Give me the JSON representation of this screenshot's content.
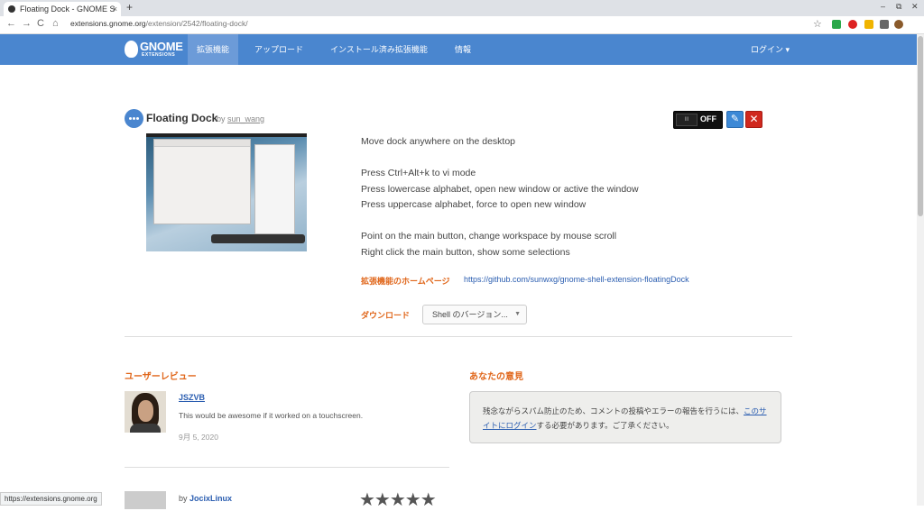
{
  "browser": {
    "tab_title": "Floating Dock - GNOME S",
    "tab_close": "×",
    "new_tab": "+",
    "url_host": "extensions.gnome.org",
    "url_path": "/extension/2542/floating-dock/",
    "back": "←",
    "forward": "→",
    "reload": "C",
    "home": "⌂",
    "star": "☆",
    "minimize": "–",
    "restore": "⧉",
    "close": "✕"
  },
  "site": {
    "logo_main": "GNOME",
    "logo_sub": "EXTENSIONS",
    "nav": [
      "拡張機能",
      "アップロード",
      "インストール済み拡張機能",
      "情報"
    ],
    "login": "ログイン ▾"
  },
  "extension": {
    "name": "Floating Dock",
    "by": "by",
    "author": "sun_wang",
    "switch_label": "OFF",
    "switch_knob": "III",
    "config_icon": "✎",
    "remove_icon": "✕",
    "description": [
      "Move dock anywhere on the desktop",
      "Press Ctrl+Alt+k to vi mode",
      "Press lowercase alphabet, open new window or active the window",
      "Press uppercase alphabet, force to open new window",
      "Point on the main button, change workspace by mouse scroll",
      "Right click the main button, show some selections"
    ],
    "homepage_label": "拡張機能のホームページ",
    "homepage_url": "https://github.com/sunwxg/gnome-shell-extension-floatingDock",
    "download_label": "ダウンロード",
    "download_select": "Shell のバージョン..."
  },
  "reviews": {
    "heading": "ユーザーレビュー",
    "items": [
      {
        "user": "JSZVB",
        "text": "This would be awesome if it worked on a touchscreen.",
        "date": "9月 5, 2020"
      },
      {
        "by": "by",
        "user": "JocixLinux",
        "stars": "★★★★★"
      }
    ]
  },
  "opinion": {
    "heading": "あなたの意見",
    "text_before": "残念ながらスパム防止のため、コメントの投稿やエラーの報告を行うには、",
    "link": "このサイトにログイン",
    "text_after": "する必要があります。ご了承ください。"
  },
  "status_url": "https://extensions.gnome.org"
}
